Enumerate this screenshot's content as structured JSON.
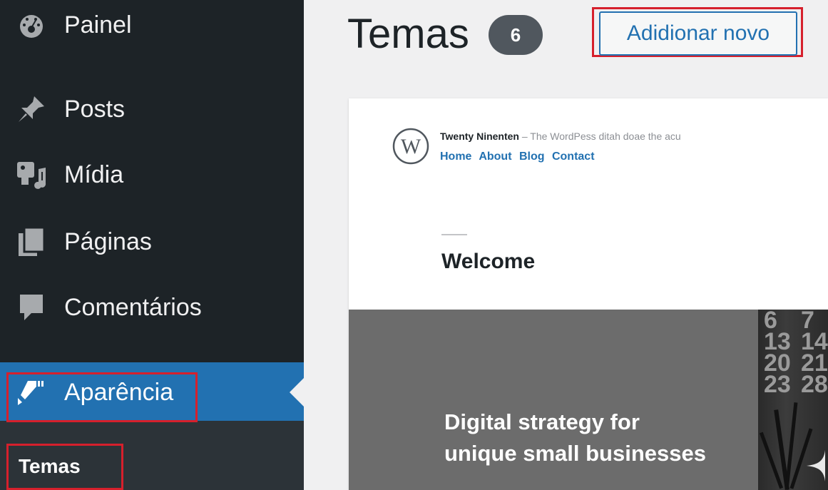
{
  "sidebar": {
    "items": [
      {
        "label": "Painel",
        "icon": "dashboard-icon"
      },
      {
        "label": "Posts",
        "icon": "pin-icon"
      },
      {
        "label": "Mídia",
        "icon": "media-icon"
      },
      {
        "label": "Páginas",
        "icon": "pages-icon"
      },
      {
        "label": "Comentários",
        "icon": "comment-icon"
      },
      {
        "label": "Aparência",
        "icon": "brush-icon",
        "active": true
      }
    ],
    "submenu": {
      "label": "Temas"
    }
  },
  "header": {
    "title": "Temas",
    "count": "6",
    "add_new_label": "Adidionar novo"
  },
  "theme_preview": {
    "site_name": "Twenty Ninenten",
    "tagline": "– The WordPess ditah doae the acu",
    "nav": [
      "Home",
      "About",
      "Blog",
      "Contact"
    ],
    "welcome": "Welcome",
    "hero_line1": "Digital strategy for",
    "hero_line2": "unique small businesses",
    "calendar_numbers": [
      "6",
      "7",
      "13",
      "14",
      "20",
      "21",
      "23",
      "28"
    ]
  },
  "colors": {
    "sidebar_bg": "#1d2327",
    "accent": "#2271b1",
    "highlight": "#d6202c"
  }
}
